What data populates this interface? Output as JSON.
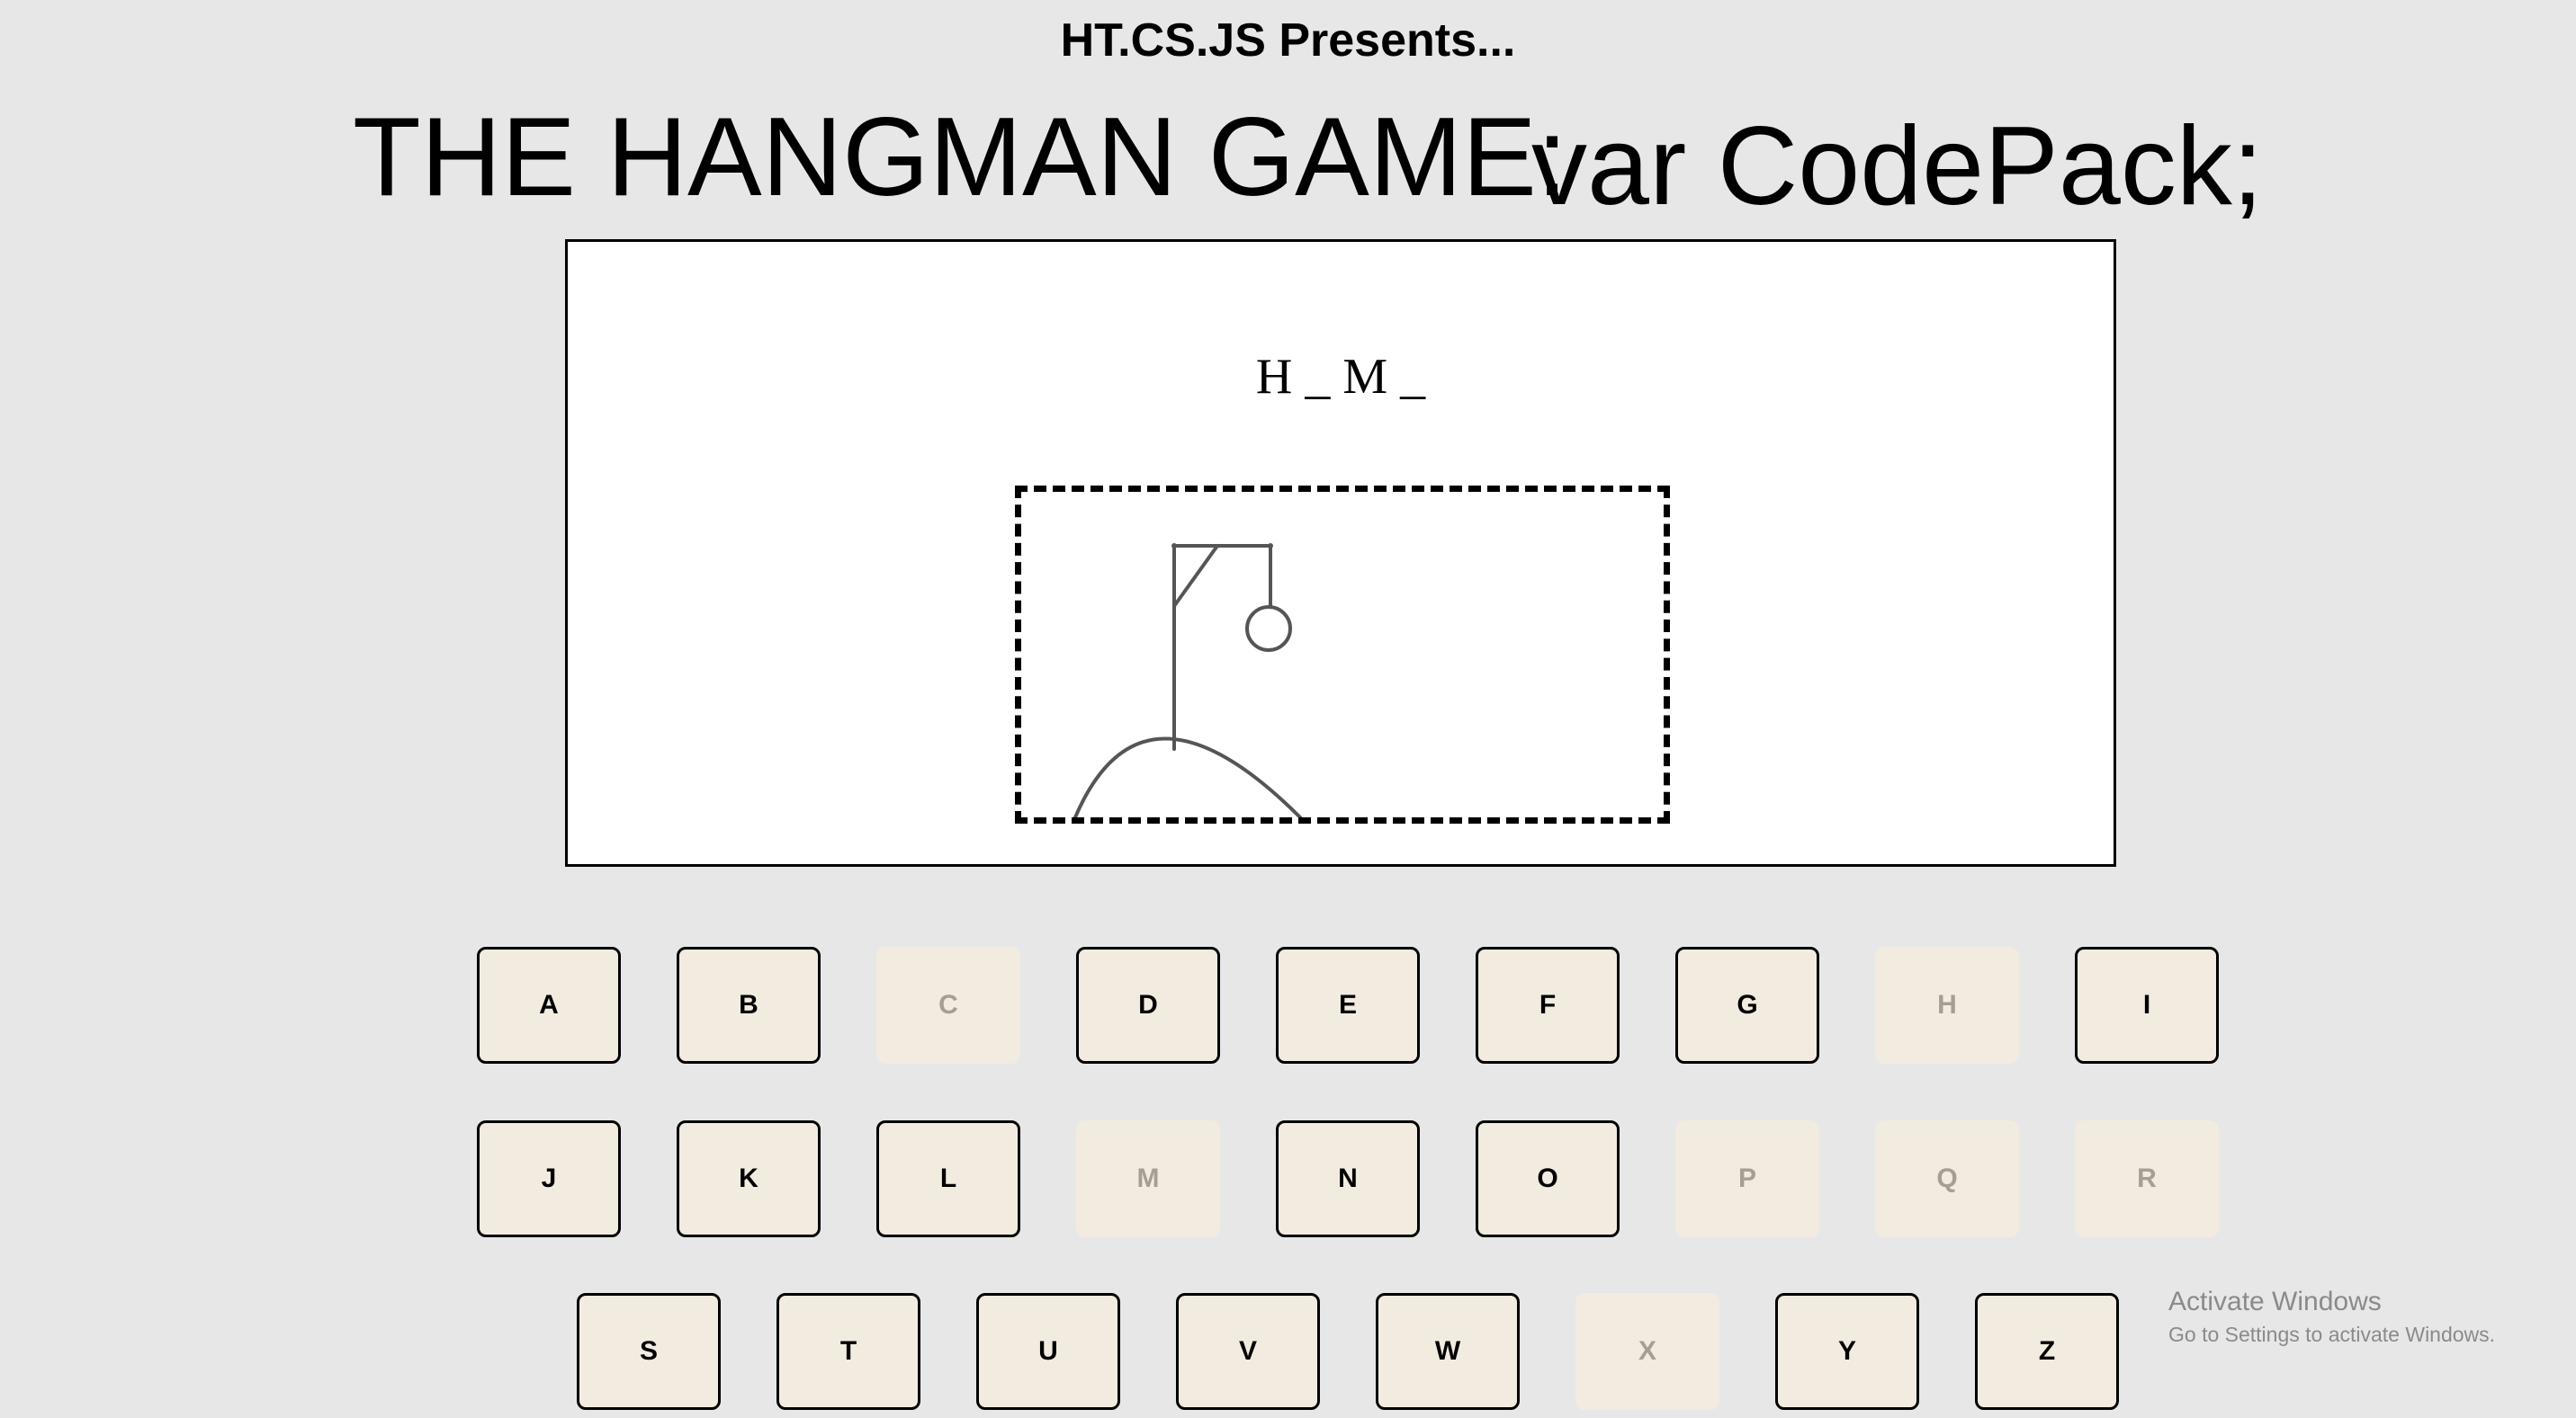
{
  "header": {
    "presents": "HT.CS.JS Presents...",
    "title": "THE HANGMAN GAME:",
    "brand": "var CodePack;"
  },
  "game": {
    "word_display": "H _ M _",
    "hangman_stage": 2
  },
  "keyboard": {
    "rows": [
      [
        {
          "letter": "A",
          "used": false
        },
        {
          "letter": "B",
          "used": false
        },
        {
          "letter": "C",
          "used": true
        },
        {
          "letter": "D",
          "used": false
        },
        {
          "letter": "E",
          "used": false
        },
        {
          "letter": "F",
          "used": false
        },
        {
          "letter": "G",
          "used": false
        },
        {
          "letter": "H",
          "used": true
        },
        {
          "letter": "I",
          "used": false
        }
      ],
      [
        {
          "letter": "J",
          "used": false
        },
        {
          "letter": "K",
          "used": false
        },
        {
          "letter": "L",
          "used": false
        },
        {
          "letter": "M",
          "used": true
        },
        {
          "letter": "N",
          "used": false
        },
        {
          "letter": "O",
          "used": false
        },
        {
          "letter": "P",
          "used": true
        },
        {
          "letter": "Q",
          "used": true
        },
        {
          "letter": "R",
          "used": true
        }
      ],
      [
        {
          "letter": "S",
          "used": false
        },
        {
          "letter": "T",
          "used": false
        },
        {
          "letter": "U",
          "used": false
        },
        {
          "letter": "V",
          "used": false
        },
        {
          "letter": "W",
          "used": false
        },
        {
          "letter": "X",
          "used": true
        },
        {
          "letter": "Y",
          "used": false
        },
        {
          "letter": "Z",
          "used": false
        }
      ]
    ]
  },
  "watermark": {
    "title": "Activate Windows",
    "subtitle": "Go to Settings to activate Windows."
  },
  "colors": {
    "background": "#e7e7e7",
    "key_background": "#f2ebe0",
    "key_used_text": "#a59e95",
    "drawing_stroke": "#555555"
  }
}
